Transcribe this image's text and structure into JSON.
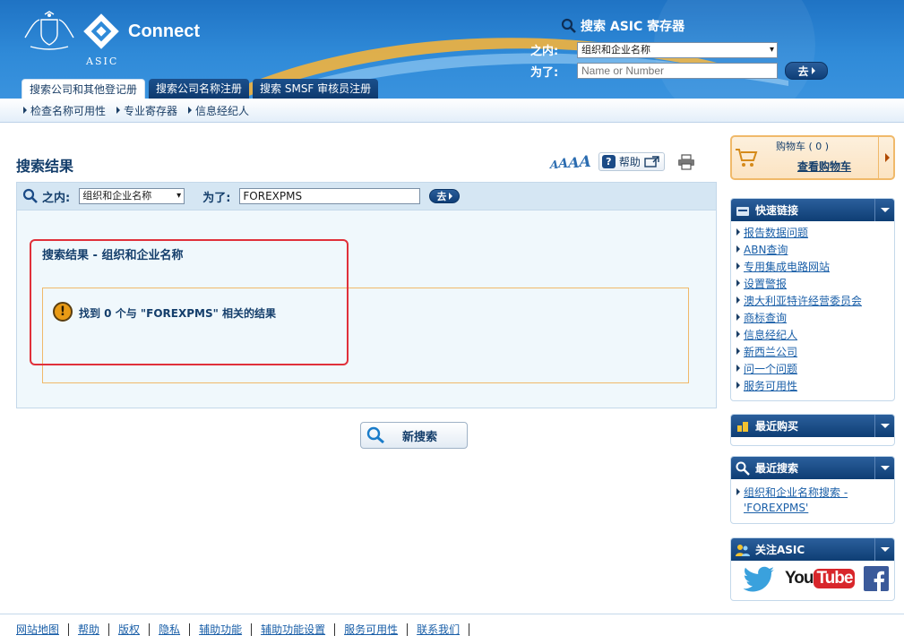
{
  "header": {
    "brand_name": "Connect",
    "org_name": "ASIC",
    "search_title": "搜索 ASIC 寄存器",
    "within_label": "之内:",
    "within_value": "组织和企业名称",
    "for_label": "为了:",
    "for_placeholder": "Name or Number",
    "go_label": "去"
  },
  "tabs": [
    {
      "label": "搜索公司和其他登记册",
      "active": true
    },
    {
      "label": "搜索公司名称注册",
      "active": false
    },
    {
      "label": "搜索 SMSF 审核员注册",
      "active": false
    }
  ],
  "subnav": [
    {
      "label": "检查名称可用性"
    },
    {
      "label": "专业寄存器"
    },
    {
      "label": "信息经纪人"
    }
  ],
  "main": {
    "page_title": "搜索结果",
    "help_label": "帮助",
    "font_sizes": [
      "A",
      "A",
      "A",
      "A"
    ],
    "search_bar": {
      "within_label": "之内:",
      "within_value": "组织和企业名称",
      "for_label": "为了:",
      "for_value": "FOREXPMS",
      "go_label": "去"
    },
    "results_heading": "搜索结果 - 组织和企业名称",
    "notice_text": "找到 0 个与 \"FOREXPMS\" 相关的结果",
    "new_search_label": "新搜索"
  },
  "sidebar": {
    "cart": {
      "title": "购物车 ( 0 )",
      "link": "查看购物车"
    },
    "quick_links": {
      "title": "快速链接",
      "items": [
        "报告数据问题",
        "ABN查询",
        "专用集成电路网站",
        "设置警报",
        "澳大利亚特许经营委员会",
        "商标查询",
        "信息经纪人",
        "新西兰公司",
        "问一个问题",
        "服务可用性"
      ]
    },
    "recent_purchases": {
      "title": "最近购买"
    },
    "recent_searches": {
      "title": "最近搜索",
      "items": [
        "组织和企业名称搜索 -",
        "'FOREXPMS'"
      ]
    },
    "follow": {
      "title": "关注ASIC",
      "youtube_you": "You",
      "youtube_tube": "Tube"
    }
  },
  "footer": {
    "links": [
      "网站地图",
      "帮助",
      "版权",
      "隐私",
      "辅助功能",
      "辅助功能设置",
      "服务可用性",
      "联系我们"
    ]
  },
  "colors": {
    "banner_blue": "#2f8ad8",
    "navy": "#143e6b",
    "highlight_red": "#e0303a",
    "notice_orange": "#f0b96a",
    "panel_bg": "#f0f8fc"
  }
}
